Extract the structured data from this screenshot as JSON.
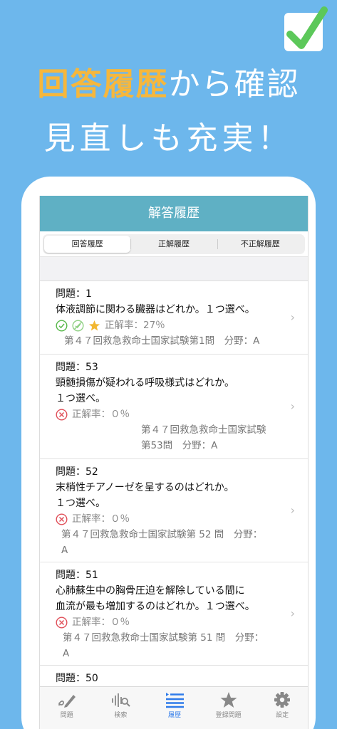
{
  "promo": {
    "line1_highlight": "回答履歴",
    "line1_rest": "から確認",
    "line2": "見直しも充実！"
  },
  "nav": {
    "title": "解答履歴"
  },
  "segments": [
    "回答履歴",
    "正解履歴",
    "不正解履歴"
  ],
  "rows": [
    {
      "q": "問題：1",
      "text1": "体液調節に関わる臓器はどれか。１つ選べ。",
      "text2": "",
      "rate": "正解率：27％",
      "src1": "第４７回救急救命士国家試験第1問　分野：A",
      "src2": ""
    },
    {
      "q": "問題：53",
      "text1": "頸髄損傷が疑われる呼吸様式はどれか。",
      "text2": "１つ選べ。",
      "rate": "正解率：０％",
      "src1": "第４７回救急救命士国家試験",
      "src2": "第53問　分野：A"
    },
    {
      "q": "問題：52",
      "text1": "末梢性チアノーゼを呈するのはどれか。",
      "text2": "１つ選べ。",
      "rate": "正解率：０％",
      "src1": "第４７回救急救命士国家試験第 52 問　分野：",
      "src2": "A"
    },
    {
      "q": "問題：51",
      "text1": "心肺蘇生中の胸骨圧迫を解除している間に",
      "text2": "血流が最も増加するのはどれか。１つ選べ。",
      "rate": "正解率：０％",
      "src1": "第４７回救急救命士国家試験第 51 問　分野：",
      "src2": "A"
    },
    {
      "q": "問題：50"
    }
  ],
  "tabs": [
    {
      "label": "問題",
      "icon": "pencil-icon"
    },
    {
      "label": "検索",
      "icon": "search-wave-icon"
    },
    {
      "label": "履歴",
      "icon": "list-icon"
    },
    {
      "label": "登録問題",
      "icon": "star-icon"
    },
    {
      "label": "設定",
      "icon": "gear-icon"
    }
  ],
  "colors": {
    "background": "#6db7ec",
    "highlight": "#f6b73c",
    "navbar": "#5fb0c4",
    "active_tab": "#2f7bea",
    "correct": "#57b84a",
    "incorrect": "#e0505a",
    "star": "#f2b731"
  }
}
